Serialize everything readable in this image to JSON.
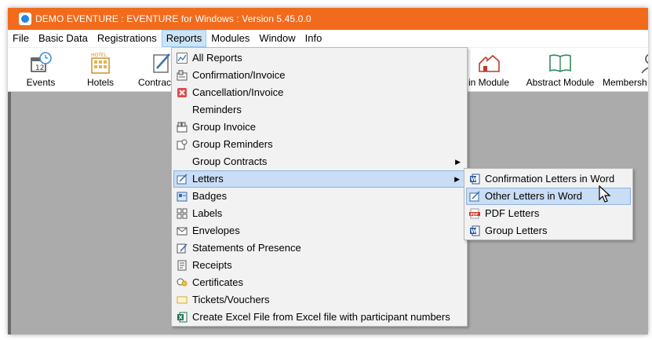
{
  "window": {
    "title": "DEMO EVENTURE : EVENTURE for Windows : Version 5.45.0.0"
  },
  "menubar": [
    "File",
    "Basic Data",
    "Registrations",
    "Reports",
    "Modules",
    "Window",
    "Info"
  ],
  "toolbar": {
    "events": "Events",
    "hotels": "Hotels",
    "hotels_sign": "HOTEL",
    "contracts": "Contrac",
    "main_module": "in Module",
    "abstract_module": "Abstract Module",
    "membership": "Membersh"
  },
  "reports_menu": [
    {
      "label": "All Reports",
      "icon": "chart-icon"
    },
    {
      "label": "Confirmation/Invoice",
      "icon": "invoice-icon"
    },
    {
      "label": "Cancellation/Invoice",
      "icon": "cancel-icon"
    },
    {
      "label": "Reminders",
      "icon": ""
    },
    {
      "label": "Group Invoice",
      "icon": "group-invoice-icon"
    },
    {
      "label": "Group Reminders",
      "icon": "group-reminder-icon"
    },
    {
      "label": "Group Contracts",
      "icon": ""
    },
    {
      "label": "Letters",
      "icon": "letter-icon"
    },
    {
      "label": "Badges",
      "icon": "badge-icon"
    },
    {
      "label": "Labels",
      "icon": "labels-icon"
    },
    {
      "label": "Envelopes",
      "icon": "envelope-icon"
    },
    {
      "label": "Statements of Presence",
      "icon": "statement-icon"
    },
    {
      "label": "Receipts",
      "icon": "receipt-icon"
    },
    {
      "label": "Certificates",
      "icon": "certificate-icon"
    },
    {
      "label": "Tickets/Vouchers",
      "icon": "ticket-icon"
    },
    {
      "label": "Create Excel File from Excel file with participant numbers",
      "icon": "excel-icon"
    }
  ],
  "letters_submenu": [
    {
      "label": "Confirmation Letters in Word",
      "icon": "word-icon"
    },
    {
      "label": "Other Letters in Word",
      "icon": "letter-edit-icon"
    },
    {
      "label": "PDF Letters",
      "icon": "pdf-icon"
    },
    {
      "label": "Group Letters",
      "icon": "word-icon"
    }
  ],
  "colors": {
    "titlebar": "#f26b1d",
    "highlight": "#c9ddf4",
    "workspace": "#ababab"
  }
}
